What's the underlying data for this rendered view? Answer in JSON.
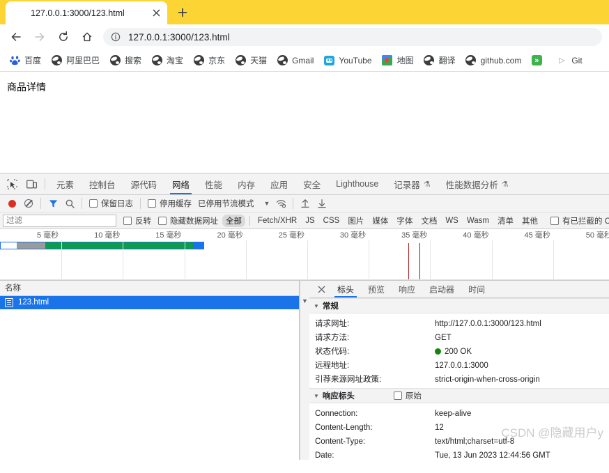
{
  "browser": {
    "tab": {
      "title": "127.0.0.1:3000/123.html",
      "favicon": "globe-icon",
      "close": "×"
    },
    "new_tab_label": "+",
    "nav": {
      "back": "back-arrow-icon",
      "forward": "forward-arrow-icon",
      "reload": "reload-icon",
      "home": "home-icon"
    },
    "omnibox": {
      "info_icon": "info-circle-icon",
      "url": "127.0.0.1:3000/123.html"
    },
    "theme_color": "#fcd535",
    "bookmarks": [
      {
        "label": "百度",
        "icon": "baidu-icon"
      },
      {
        "label": "阿里巴巴",
        "icon": "globe-icon"
      },
      {
        "label": "搜索",
        "icon": "globe-icon"
      },
      {
        "label": "淘宝",
        "icon": "globe-icon"
      },
      {
        "label": "京东",
        "icon": "globe-icon"
      },
      {
        "label": "天猫",
        "icon": "globe-icon"
      },
      {
        "label": "Gmail",
        "icon": "globe-icon"
      },
      {
        "label": "YouTube",
        "icon": "youtube-icon"
      },
      {
        "label": "地图",
        "icon": "maps-icon"
      },
      {
        "label": "翻译",
        "icon": "globe-icon"
      },
      {
        "label": "github.com",
        "icon": "globe-icon"
      },
      {
        "label": "",
        "icon": "green-chevrons-icon"
      },
      {
        "label": "Git",
        "icon": "play-triangle-icon"
      }
    ]
  },
  "page": {
    "heading": "商品详情"
  },
  "devtools": {
    "inspect_icon": "inspect-element-icon",
    "device_icon": "device-toolbar-icon",
    "tabs": [
      {
        "label": "元素",
        "active": false
      },
      {
        "label": "控制台",
        "active": false
      },
      {
        "label": "源代码",
        "active": false
      },
      {
        "label": "网络",
        "active": true
      },
      {
        "label": "性能",
        "active": false
      },
      {
        "label": "内存",
        "active": false
      },
      {
        "label": "应用",
        "active": false
      },
      {
        "label": "安全",
        "active": false
      },
      {
        "label": "Lighthouse",
        "active": false
      },
      {
        "label": "记录器",
        "active": false,
        "badge": "⚗"
      },
      {
        "label": "性能数据分析",
        "active": false,
        "badge": "⚗"
      }
    ],
    "toolbar": {
      "record_icon": "record-stop-icon",
      "clear_icon": "clear-network-icon",
      "filter_icon": "filter-funnel-icon",
      "search_icon": "search-icon",
      "preserve_log": "保留日志",
      "disable_cache": "停用缓存",
      "throttle_value": "已停用节流模式",
      "throttle_caret": "▼",
      "wifi_icon": "network-conditions-icon",
      "import_icon": "import-har-icon",
      "export_icon": "export-har-icon"
    },
    "filterbar": {
      "filter_placeholder": "过滤",
      "invert": "反转",
      "hide_data_urls": "隐藏数据网址",
      "types": [
        "全部",
        "Fetch/XHR",
        "JS",
        "CSS",
        "图片",
        "媒体",
        "字体",
        "文档",
        "WS",
        "Wasm",
        "清单",
        "其他"
      ],
      "selected_type": "全部",
      "blocked_cookies": "有已拦截的 Cook"
    },
    "overview": {
      "unit": "毫秒",
      "ticks": [
        5,
        10,
        15,
        20,
        25,
        30,
        35,
        40,
        45,
        50
      ],
      "tick_labels": [
        "5 毫秒",
        "10 毫秒",
        "15 毫秒",
        "20 毫秒",
        "25 毫秒",
        "30 毫秒",
        "35 毫秒",
        "40 毫秒",
        "45 毫秒",
        "50 毫秒"
      ],
      "bar": {
        "start_ms": 0,
        "end_ms": 16.6,
        "segments": [
          {
            "name": "queueing",
            "color": "#ffffff",
            "pct": 8
          },
          {
            "name": "stalled",
            "color": "#9a9a9a",
            "pct": 14
          },
          {
            "name": "waiting",
            "color": "#0e9b4a",
            "pct": 73
          },
          {
            "name": "download",
            "color": "#1a73e8",
            "pct": 5
          }
        ],
        "border_color": "#1a73e8"
      },
      "markers": [
        {
          "name": "dom-content-loaded",
          "color": "#b22222",
          "ms": 33.2
        },
        {
          "name": "load",
          "color": "#27348b",
          "ms": 34.1
        }
      ]
    },
    "requests": {
      "column_name": "名称",
      "rows": [
        {
          "name": "123.html",
          "icon": "document-icon",
          "selected": true
        }
      ]
    },
    "detail": {
      "close_icon": "close-icon",
      "tabs": [
        {
          "label": "标头",
          "active": true
        },
        {
          "label": "预览",
          "active": false
        },
        {
          "label": "响应",
          "active": false
        },
        {
          "label": "启动器",
          "active": false
        },
        {
          "label": "时间",
          "active": false
        }
      ],
      "general": {
        "title": "常规",
        "rows": [
          {
            "key": "请求网址:",
            "value": "http://127.0.0.1:3000/123.html"
          },
          {
            "key": "请求方法:",
            "value": "GET"
          },
          {
            "key": "状态代码:",
            "value": "200 OK",
            "status_dot": "#12850a"
          },
          {
            "key": "远程地址:",
            "value": "127.0.0.1:3000"
          },
          {
            "key": "引荐来源网址政策:",
            "value": "strict-origin-when-cross-origin"
          }
        ]
      },
      "response_headers": {
        "title": "响应标头",
        "raw_label": "原始",
        "rows": [
          {
            "key": "Connection:",
            "value": "keep-alive"
          },
          {
            "key": "Content-Length:",
            "value": "12"
          },
          {
            "key": "Content-Type:",
            "value": "text/html;charset=utf-8"
          },
          {
            "key": "Date:",
            "value": "Tue, 13 Jun 2023 12:44:56 GMT"
          }
        ]
      },
      "watermark": "CSDN @隐藏用户y"
    }
  }
}
